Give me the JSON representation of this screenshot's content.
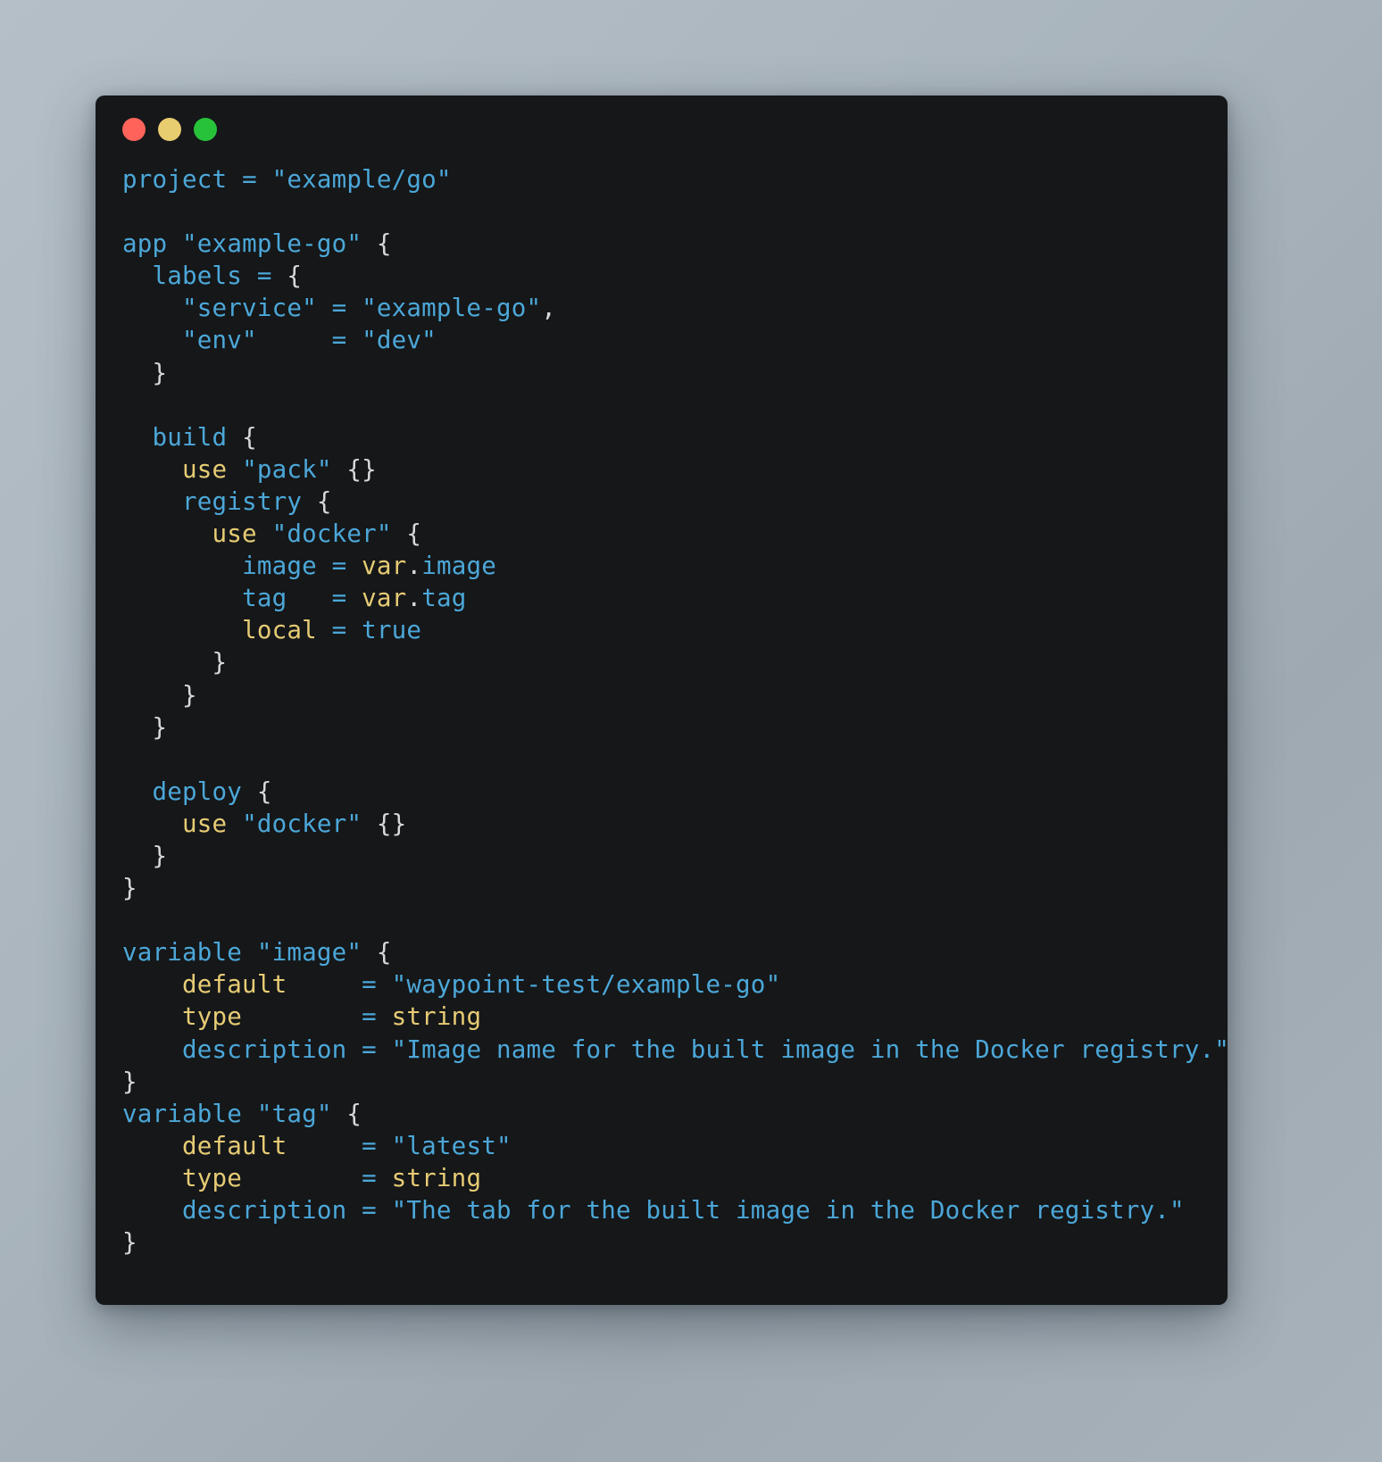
{
  "window": {
    "name": "code-snippet-window",
    "background_color": "#151719",
    "traffic_lights": [
      {
        "name": "close-button",
        "color": "#ff6359",
        "label": "close"
      },
      {
        "name": "minimize-button",
        "color": "#e8cc70",
        "label": "minimize"
      },
      {
        "name": "maximize-button",
        "color": "#28c23a",
        "label": "maximize"
      }
    ]
  },
  "theme": {
    "identifier_color": "#4ca7d8",
    "attribute_color": "#e6cb74",
    "punctuation_color": "#d8d8d8",
    "backdrop_color": "#aab5bd"
  },
  "code": {
    "language": "hcl",
    "lines": [
      {
        "n": 1,
        "text": "project = \"example/go\""
      },
      {
        "n": 2,
        "text": ""
      },
      {
        "n": 3,
        "text": "app \"example-go\" {"
      },
      {
        "n": 4,
        "text": "  labels = {"
      },
      {
        "n": 5,
        "text": "    \"service\" = \"example-go\","
      },
      {
        "n": 6,
        "text": "    \"env\"     = \"dev\""
      },
      {
        "n": 7,
        "text": "  }"
      },
      {
        "n": 8,
        "text": ""
      },
      {
        "n": 9,
        "text": "  build {"
      },
      {
        "n": 10,
        "text": "    use \"pack\" {}"
      },
      {
        "n": 11,
        "text": "    registry {"
      },
      {
        "n": 12,
        "text": "      use \"docker\" {"
      },
      {
        "n": 13,
        "text": "        image = var.image"
      },
      {
        "n": 14,
        "text": "        tag   = var.tag"
      },
      {
        "n": 15,
        "text": "        local = true"
      },
      {
        "n": 16,
        "text": "      }"
      },
      {
        "n": 17,
        "text": "    }"
      },
      {
        "n": 18,
        "text": "  }"
      },
      {
        "n": 19,
        "text": ""
      },
      {
        "n": 20,
        "text": "  deploy {"
      },
      {
        "n": 21,
        "text": "    use \"docker\" {}"
      },
      {
        "n": 22,
        "text": "  }"
      },
      {
        "n": 23,
        "text": "}"
      },
      {
        "n": 24,
        "text": ""
      },
      {
        "n": 25,
        "text": "variable \"image\" {"
      },
      {
        "n": 26,
        "text": "    default     = \"waypoint-test/example-go\""
      },
      {
        "n": 27,
        "text": "    type        = string"
      },
      {
        "n": 28,
        "text": "    description = \"Image name for the built image in the Docker registry.\""
      },
      {
        "n": 29,
        "text": "}"
      },
      {
        "n": 30,
        "text": "variable \"tag\" {"
      },
      {
        "n": 31,
        "text": "    default     = \"latest\""
      },
      {
        "n": 32,
        "text": "    type        = string"
      },
      {
        "n": 33,
        "text": "    description = \"The tab for the built image in the Docker registry.\""
      },
      {
        "n": 34,
        "text": "}"
      }
    ],
    "tokens": {
      "l1": [
        [
          "project",
          "kw"
        ],
        [
          " ",
          "pu"
        ],
        [
          "=",
          "op"
        ],
        [
          " ",
          "pu"
        ],
        [
          "\"example/go\"",
          "kw"
        ]
      ],
      "l3": [
        [
          "app",
          "kw"
        ],
        [
          " ",
          "pu"
        ],
        [
          "\"example-go\"",
          "kw"
        ],
        [
          " ",
          "pu"
        ],
        [
          "{",
          "pu"
        ]
      ],
      "l4": [
        [
          "  ",
          "pu"
        ],
        [
          "labels",
          "kw"
        ],
        [
          " ",
          "pu"
        ],
        [
          "=",
          "op"
        ],
        [
          " ",
          "pu"
        ],
        [
          "{",
          "pu"
        ]
      ],
      "l5": [
        [
          "    ",
          "pu"
        ],
        [
          "\"service\"",
          "kw"
        ],
        [
          " ",
          "pu"
        ],
        [
          "=",
          "op"
        ],
        [
          " ",
          "pu"
        ],
        [
          "\"example-go\"",
          "kw"
        ],
        [
          ",",
          "pu"
        ]
      ],
      "l6": [
        [
          "    ",
          "pu"
        ],
        [
          "\"env\"",
          "kw"
        ],
        [
          "     ",
          "pu"
        ],
        [
          "=",
          "op"
        ],
        [
          " ",
          "pu"
        ],
        [
          "\"dev\"",
          "kw"
        ]
      ],
      "l7": [
        [
          "  ",
          "pu"
        ],
        [
          "}",
          "pu"
        ]
      ],
      "l9": [
        [
          "  ",
          "pu"
        ],
        [
          "build",
          "kw"
        ],
        [
          " ",
          "pu"
        ],
        [
          "{",
          "pu"
        ]
      ],
      "l10": [
        [
          "    ",
          "pu"
        ],
        [
          "use",
          "at"
        ],
        [
          " ",
          "pu"
        ],
        [
          "\"pack\"",
          "kw"
        ],
        [
          " ",
          "pu"
        ],
        [
          "{}",
          "pu"
        ]
      ],
      "l11": [
        [
          "    ",
          "pu"
        ],
        [
          "registry",
          "kw"
        ],
        [
          " ",
          "pu"
        ],
        [
          "{",
          "pu"
        ]
      ],
      "l12": [
        [
          "      ",
          "pu"
        ],
        [
          "use",
          "at"
        ],
        [
          " ",
          "pu"
        ],
        [
          "\"docker\"",
          "kw"
        ],
        [
          " ",
          "pu"
        ],
        [
          "{",
          "pu"
        ]
      ],
      "l13": [
        [
          "        ",
          "pu"
        ],
        [
          "image",
          "kw"
        ],
        [
          " ",
          "pu"
        ],
        [
          "=",
          "op"
        ],
        [
          " ",
          "pu"
        ],
        [
          "var",
          "at"
        ],
        [
          ".",
          "pu"
        ],
        [
          "image",
          "kw"
        ]
      ],
      "l14": [
        [
          "        ",
          "pu"
        ],
        [
          "tag",
          "kw"
        ],
        [
          "   ",
          "pu"
        ],
        [
          "=",
          "op"
        ],
        [
          " ",
          "pu"
        ],
        [
          "var",
          "at"
        ],
        [
          ".",
          "pu"
        ],
        [
          "tag",
          "kw"
        ]
      ],
      "l15": [
        [
          "        ",
          "pu"
        ],
        [
          "local",
          "at"
        ],
        [
          " ",
          "pu"
        ],
        [
          "=",
          "op"
        ],
        [
          " ",
          "pu"
        ],
        [
          "true",
          "kw"
        ]
      ],
      "l16": [
        [
          "      ",
          "pu"
        ],
        [
          "}",
          "pu"
        ]
      ],
      "l17": [
        [
          "    ",
          "pu"
        ],
        [
          "}",
          "pu"
        ]
      ],
      "l18": [
        [
          "  ",
          "pu"
        ],
        [
          "}",
          "pu"
        ]
      ],
      "l20": [
        [
          "  ",
          "pu"
        ],
        [
          "deploy",
          "kw"
        ],
        [
          " ",
          "pu"
        ],
        [
          "{",
          "pu"
        ]
      ],
      "l21": [
        [
          "    ",
          "pu"
        ],
        [
          "use",
          "at"
        ],
        [
          " ",
          "pu"
        ],
        [
          "\"docker\"",
          "kw"
        ],
        [
          " ",
          "pu"
        ],
        [
          "{}",
          "pu"
        ]
      ],
      "l22": [
        [
          "  ",
          "pu"
        ],
        [
          "}",
          "pu"
        ]
      ],
      "l23": [
        [
          "}",
          "pu"
        ]
      ],
      "l25": [
        [
          "variable",
          "kw"
        ],
        [
          " ",
          "pu"
        ],
        [
          "\"image\"",
          "kw"
        ],
        [
          " ",
          "pu"
        ],
        [
          "{",
          "pu"
        ]
      ],
      "l26": [
        [
          "    ",
          "pu"
        ],
        [
          "default",
          "at"
        ],
        [
          "     ",
          "pu"
        ],
        [
          "=",
          "op"
        ],
        [
          " ",
          "pu"
        ],
        [
          "\"waypoint-test/example-go\"",
          "kw"
        ]
      ],
      "l27": [
        [
          "    ",
          "pu"
        ],
        [
          "type",
          "at"
        ],
        [
          "        ",
          "pu"
        ],
        [
          "=",
          "op"
        ],
        [
          " ",
          "pu"
        ],
        [
          "string",
          "at"
        ]
      ],
      "l28": [
        [
          "    ",
          "pu"
        ],
        [
          "description",
          "kw"
        ],
        [
          " ",
          "pu"
        ],
        [
          "=",
          "op"
        ],
        [
          " ",
          "pu"
        ],
        [
          "\"Image name for the built image in the Docker registry.\"",
          "kw"
        ]
      ],
      "l29": [
        [
          "}",
          "pu"
        ]
      ],
      "l30": [
        [
          "variable",
          "kw"
        ],
        [
          " ",
          "pu"
        ],
        [
          "\"tag\"",
          "kw"
        ],
        [
          " ",
          "pu"
        ],
        [
          "{",
          "pu"
        ]
      ],
      "l31": [
        [
          "    ",
          "pu"
        ],
        [
          "default",
          "at"
        ],
        [
          "     ",
          "pu"
        ],
        [
          "=",
          "op"
        ],
        [
          " ",
          "pu"
        ],
        [
          "\"latest\"",
          "kw"
        ]
      ],
      "l32": [
        [
          "    ",
          "pu"
        ],
        [
          "type",
          "at"
        ],
        [
          "        ",
          "pu"
        ],
        [
          "=",
          "op"
        ],
        [
          " ",
          "pu"
        ],
        [
          "string",
          "at"
        ]
      ],
      "l33": [
        [
          "    ",
          "pu"
        ],
        [
          "description",
          "kw"
        ],
        [
          " ",
          "pu"
        ],
        [
          "=",
          "op"
        ],
        [
          " ",
          "pu"
        ],
        [
          "\"The tab for the built image in the Docker registry.\"",
          "kw"
        ]
      ],
      "l34": [
        [
          "}",
          "pu"
        ]
      ]
    }
  }
}
